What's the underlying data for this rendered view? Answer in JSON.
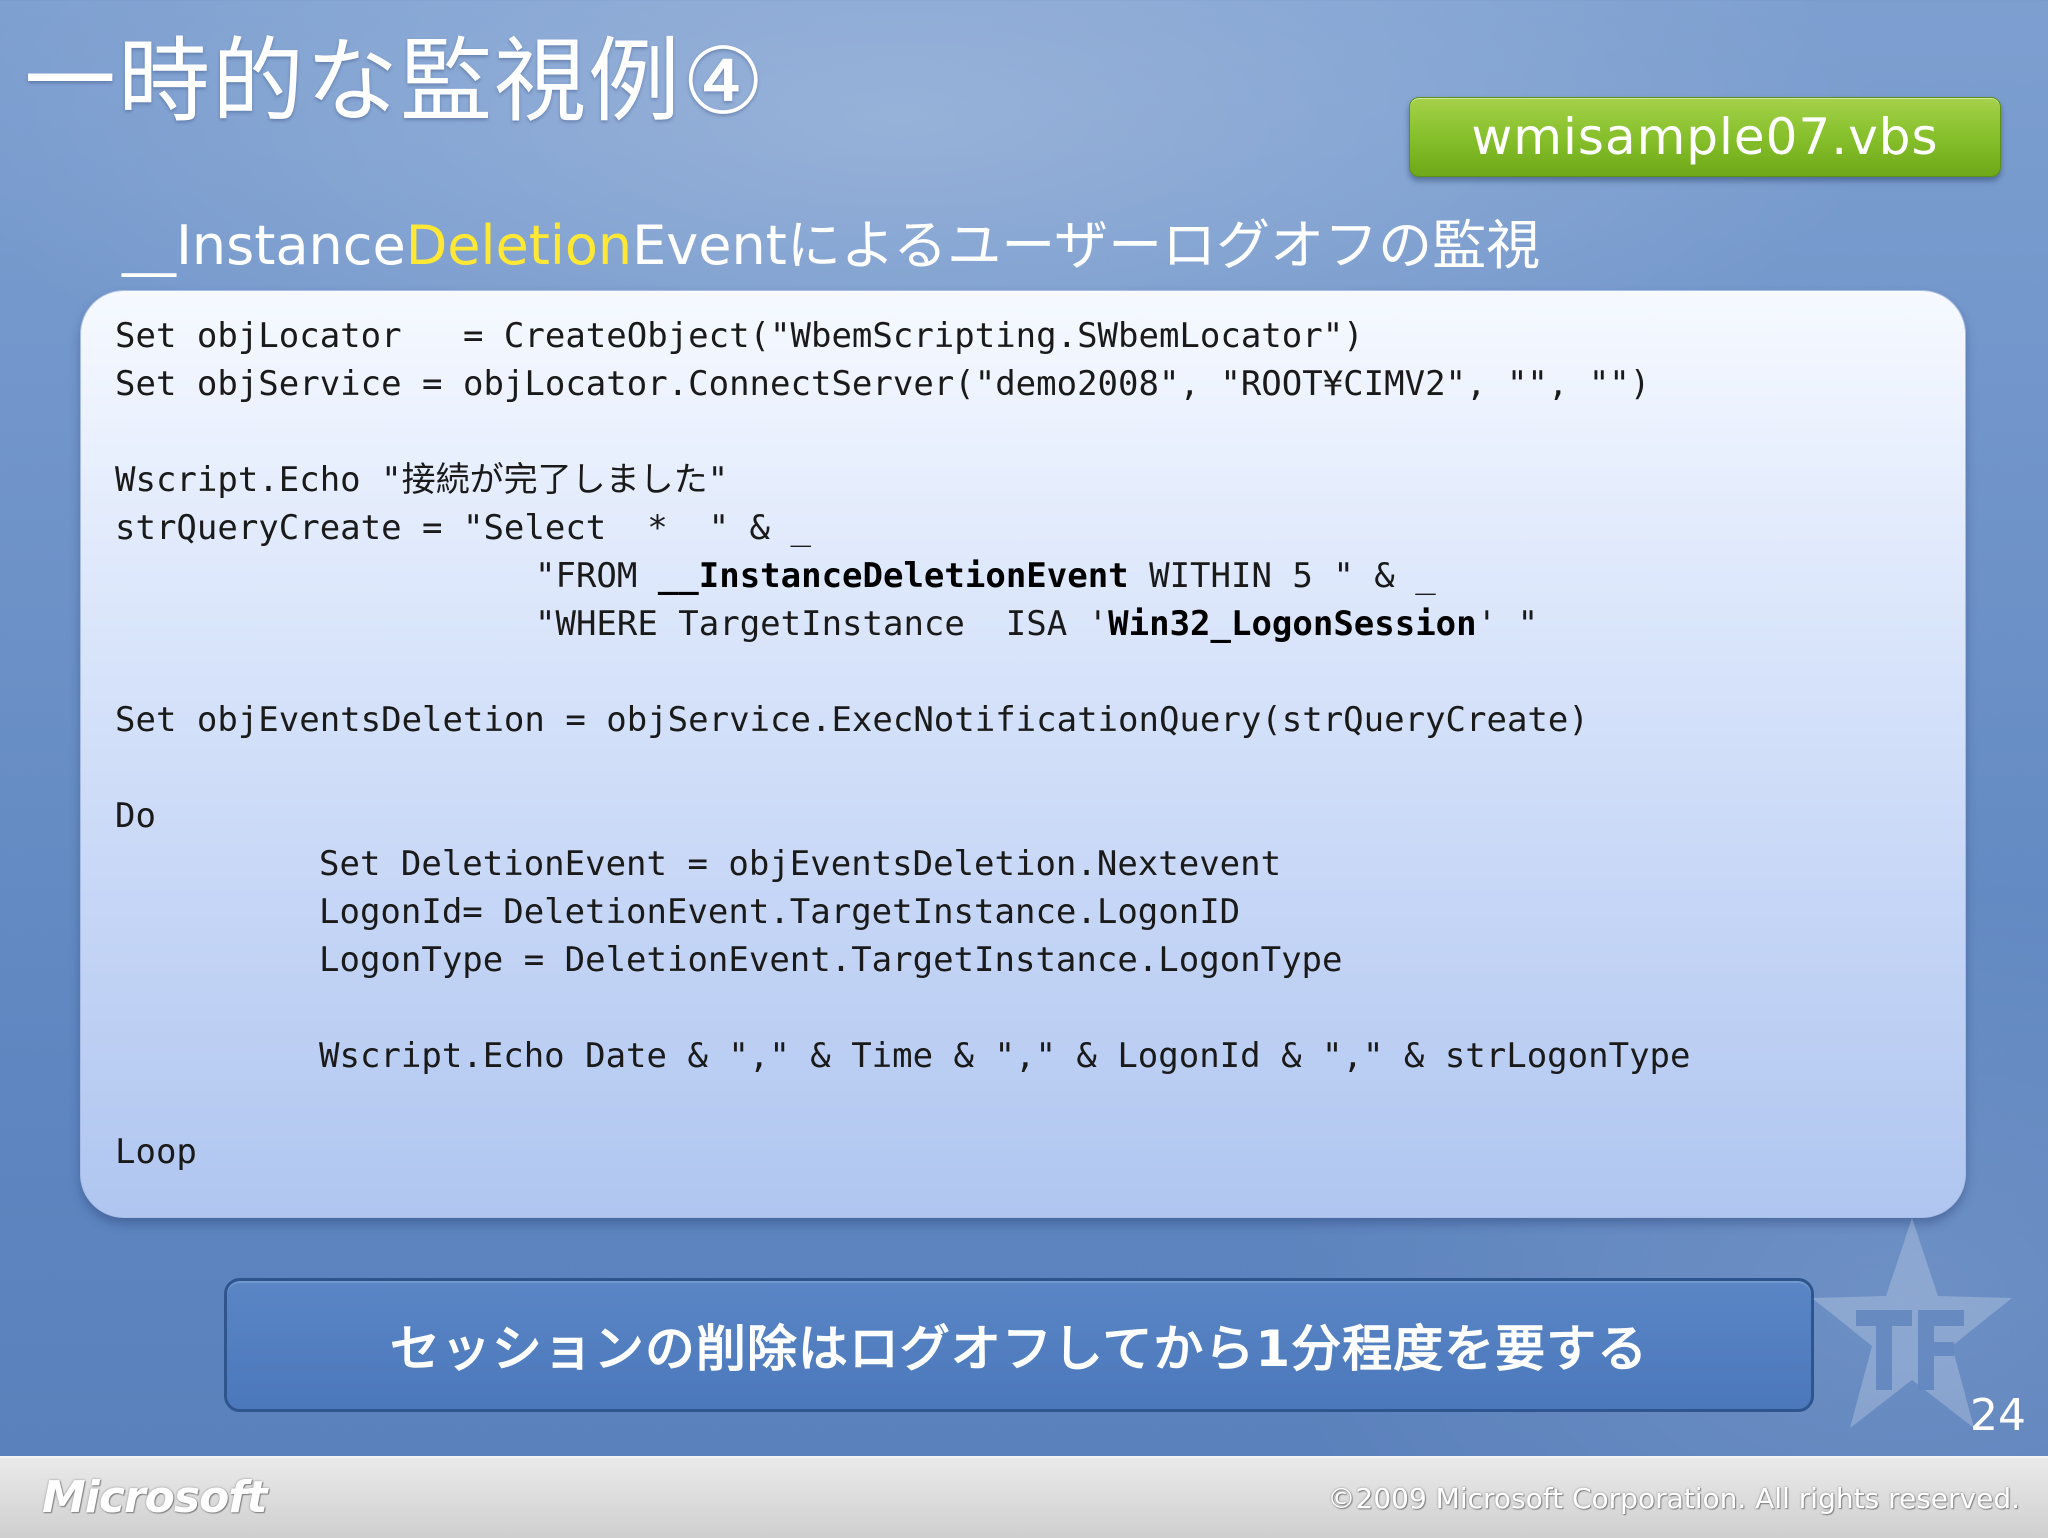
{
  "slide": {
    "title": "一時的な監視例④",
    "badge": "wmisample07.vbs",
    "subtitle": {
      "prefix": "__Instance",
      "highlight": "Deletion",
      "suffix": "Eventによるユーザーログオフの監視"
    },
    "page_number": "24"
  },
  "code": {
    "line1": "Set objLocator   = CreateObject(\"WbemScripting.SWbemLocator\")",
    "line2": "Set objService = objLocator.ConnectServer(\"demo2008\", \"ROOT¥CIMV2\", \"\", \"\")",
    "line3": "Wscript.Echo \"接続が完了しました\"",
    "line4": "strQueryCreate = \"Select  *  \" & _",
    "line5_pre": "\"FROM ",
    "line5_bold": "__InstanceDeletionEvent",
    "line5_post": " WITHIN 5 \" & _",
    "line6_pre": "\"WHERE TargetInstance  ISA '",
    "line6_bold": "Win32_LogonSession",
    "line6_post": "' \"",
    "line7": "Set objEventsDeletion = objService.ExecNotificationQuery(strQueryCreate)",
    "line8": "Do",
    "line9": "Set DeletionEvent = objEventsDeletion.Nextevent",
    "line10": "LogonId= DeletionEvent.TargetInstance.LogonID",
    "line11": "LogonType = DeletionEvent.TargetInstance.LogonType",
    "line12": "Wscript.Echo Date & \",\" & Time & \",\" & LogonId & \",\" & strLogonType",
    "line13": "Loop"
  },
  "callout": "セッションの削除はログオフしてから1分程度を要する",
  "footer": {
    "logo": "Microsoft",
    "copyright": "©2009 Microsoft Corporation. All rights reserved."
  },
  "icons": {
    "watermark": "tf-star-logo-icon"
  },
  "colors": {
    "highlight": "#ffe834",
    "badge_green": "#86c02b",
    "callout_blue": "#4b78bb"
  }
}
